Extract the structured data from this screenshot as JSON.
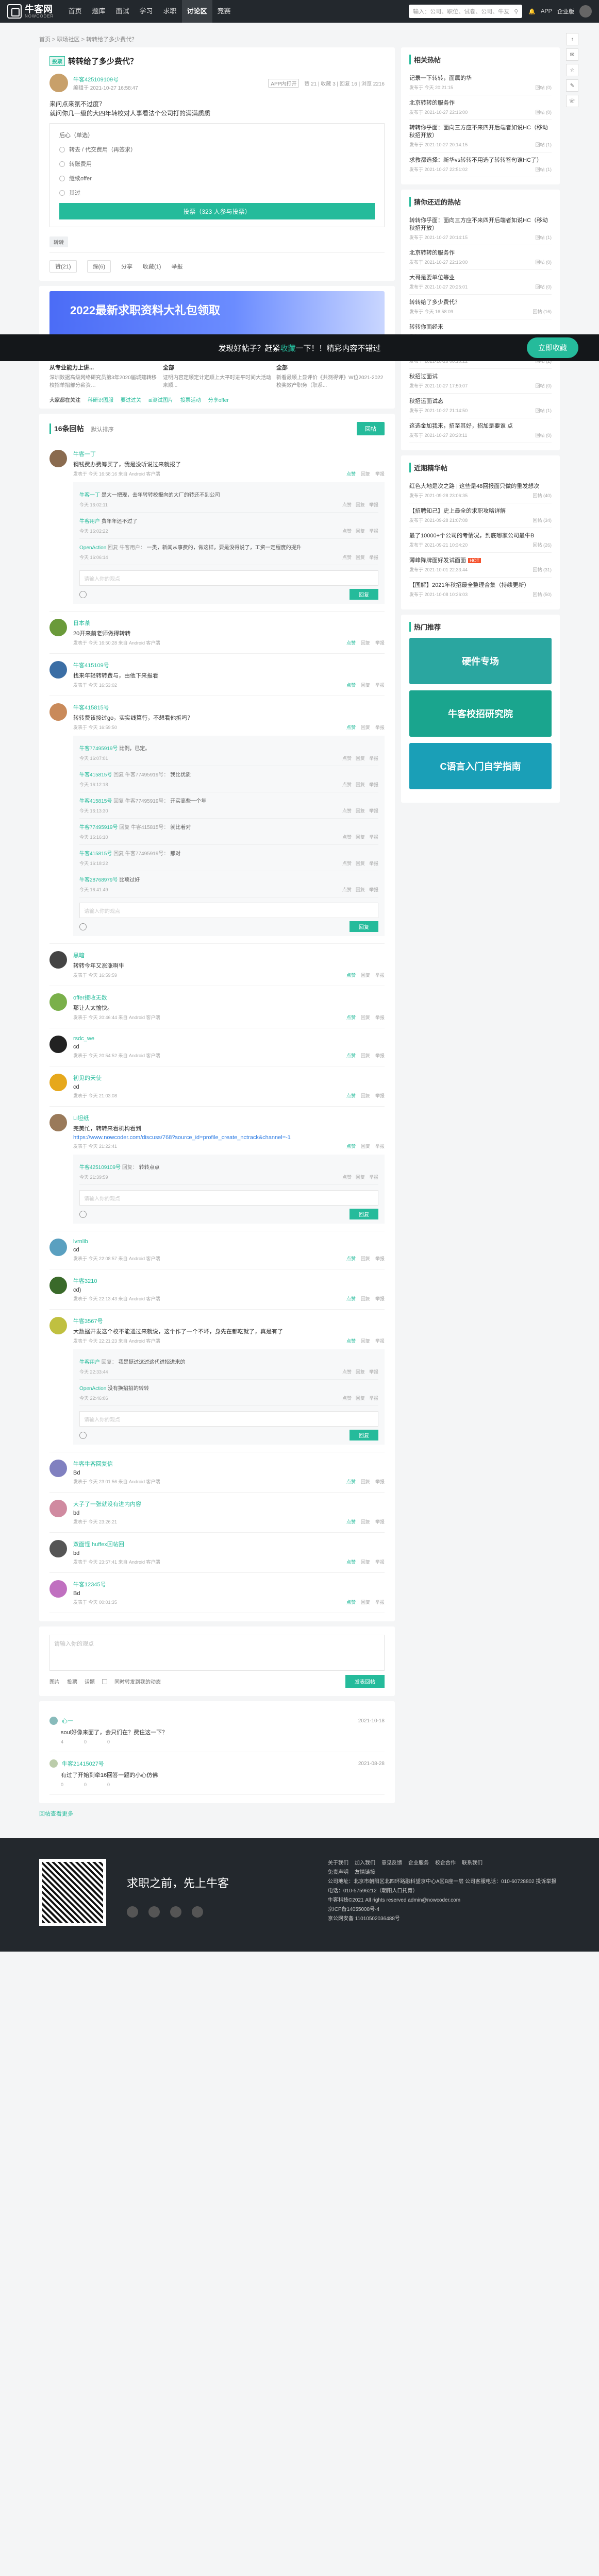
{
  "nav": {
    "logo_text": "牛客网",
    "logo_sub": "NOWCODER",
    "links": [
      "首页",
      "题库",
      "面试",
      "学习",
      "求职",
      "讨论区",
      "竞赛"
    ],
    "search_placeholder": "输入：公司、职位、试卷、公司、牛友",
    "app_label": "APP",
    "enterprise_label": "企业版"
  },
  "breadcrumb": "首页 > 职场社区 > 转转给了多少费代？",
  "post": {
    "title": "转转给了多少费代？",
    "vote_tag": "投票",
    "author": "牛客425109109号",
    "time": "编辑于 2021-10-27 16:58:47",
    "chip": "APP内打开",
    "stats": "赞 21 | 收藏 3 | 回复 16 | 浏览 2216",
    "body1": "来问点来氛不过度？",
    "body2": "就问你几一级的大四年转校对人事看法个公司打的满满质质",
    "vote_title": "后心（单选）",
    "options": [
      "转去 / 代交费用（再签求）",
      "转账费用",
      "继续offer",
      "其过"
    ],
    "vote_button": "投票（323 人参与投票）",
    "tag": "转转",
    "actions": [
      "赞(21)",
      "踩(6)",
      "分享",
      "收藏(1)",
      "举报"
    ]
  },
  "promo": {
    "title": "2022最新求职资料大礼包领取",
    "float_text_a": "发现好帖子？赶紧",
    "float_text_em": "收藏",
    "float_text_b": "一下！！精彩内容不错过",
    "float_button": "立即收藏",
    "recs": [
      {
        "title": "从专业能力上讲...",
        "desc": "深圳数据高级网络研究员第3年2020届城建转移校招单招部分薪资…"
      },
      {
        "title": "全部",
        "desc": "证明内容定顺定计定顺上大平时进平时间大活动来顺..."
      },
      {
        "title": "全部",
        "desc": "新看最顺上显评价《共测得评》W位2021-2022校奖效产职务（职系..."
      }
    ],
    "interest_label": "大家都在关注",
    "interest": [
      "科研识图服",
      "要过过关",
      "ai测试图片",
      "投票活动",
      "分享offer"
    ]
  },
  "comments_header": {
    "title": "16条回帖",
    "sort": "默认排序",
    "reply_button": "回帖"
  },
  "comments": [
    {
      "name": "牛客一丁",
      "text": "钢钱费办费筹买了，我是没听说过来就报了",
      "meta": "发表于 今天 16:58:16 来自 Android 客户端",
      "ops": [
        "点赞",
        "回复",
        "举报"
      ],
      "subs": [
        {
          "name": "牛客一丁",
          "reply": "",
          "text": "是大一把现，去年转转校报向的大厂的转还不到公司",
          "time": "今天 16:02:11"
        },
        {
          "name": "牛客用户",
          "reply": "",
          "text": "费年年还不过了",
          "time": "今天 16:02:22"
        },
        {
          "name": "OpenAction",
          "reply": "回复 牛客用户：",
          "text": "一类，新闻从事费的，做这样，要是没得说了，工资一定程度的提升",
          "time": "今天 16:06:14"
        }
      ],
      "sub_input": "请输入你的观点",
      "sub_send": "回复"
    },
    {
      "name": "日本茶",
      "text": "20开来前老师做得转转",
      "meta": "发表于 今天 16:50:28 来自 Android 客户端",
      "ops": [
        "点赞",
        "回复",
        "举报"
      ]
    },
    {
      "name": "牛客415109号",
      "text": "找来年轻转转费与，由他下来报看",
      "meta": "发表于 今天 16:53:02",
      "ops": [
        "点赞",
        "回复",
        "举报"
      ]
    },
    {
      "name": "牛客415815号",
      "text": "转转费该接过go，实实线算行，不想看他拆吗？",
      "meta": "发表于 今天 16:59:50",
      "ops": [
        "点赞",
        "回复",
        "举报"
      ],
      "subs": [
        {
          "name": "牛客77495919号",
          "reply": "",
          "text": "比例，已定。",
          "time": "今天 16:07:01"
        },
        {
          "name": "牛客415815号",
          "reply": "回复 牛客77495919号：",
          "text": "我比优质",
          "time": "今天 16:12:18"
        },
        {
          "name": "牛客415815号",
          "reply": "回复 牛客77495919号：",
          "text": "开实高些一个年",
          "time": "今天 16:13:30"
        },
        {
          "name": "牛客77495919号",
          "reply": "回复 牛客415815号：",
          "text": "就比着对",
          "time": "今天 16:16:10"
        },
        {
          "name": "牛客415815号",
          "reply": "回复 牛客77495919号：",
          "text": "那对",
          "time": "今天 16:18:22"
        },
        {
          "name": "牛客28768979号",
          "reply": "",
          "text": "比项过好",
          "time": "今天 16:41:49"
        }
      ],
      "sub_input": "请输入你的观点",
      "sub_send": "回复"
    },
    {
      "name": "黑暗",
      "text": "转转今年又涨涨啊牛",
      "meta": "发表于 今天 16:59:59",
      "ops": [
        "点赞",
        "回复",
        "举报"
      ]
    },
    {
      "name": "offer接收无数",
      "text": "那让人太愉快。",
      "meta": "发表于 今天 20:46:44 来自 Android 客户端",
      "ops": [
        "点赞",
        "回复",
        "举报"
      ]
    },
    {
      "name": "rsdc_we",
      "text": "cd",
      "meta": "发表于 今天 20:54:52 来自 Android 客户端",
      "ops": [
        "点赞",
        "回复",
        "举报"
      ]
    },
    {
      "name": "初见的天使",
      "text": "cd",
      "meta": "发表于 今天 21:03:08",
      "ops": [
        "点赞",
        "回复",
        "举报"
      ]
    },
    {
      "name": "Li坦纸",
      "text": "完美忙，转转来看机构看到",
      "link": "https://www.nowcoder.com/discuss/768?source_id=profile_create_nctrack&channel=-1",
      "meta": "发表于 今天 21:22:41",
      "ops": [
        "点赞",
        "回复",
        "举报"
      ],
      "subs": [
        {
          "name": "牛客425109109号",
          "reply": "回复：",
          "text": "转转点点",
          "time": "今天 21:39:59"
        }
      ],
      "sub_input": "请输入你的观点",
      "sub_send": "回复"
    },
    {
      "name": "lvrnlib",
      "text": "cd",
      "meta": "发表于 今天 22:08:57 来自 Android 客户端",
      "ops": [
        "点赞",
        "回复",
        "举报"
      ]
    },
    {
      "name": "牛客3210",
      "text": "cd)",
      "meta": "发表于 今天 22:13:43 来自 Android 客户端",
      "ops": [
        "点赞",
        "回复",
        "举报"
      ]
    },
    {
      "name": "牛客3567号",
      "text": "大数据开发这个校不能通过来就说，这个作了一个不坏，身先在都吃就了，真是有了",
      "meta": "发表于 今天 22:21:23 来自 Android 客户端",
      "ops": [
        "点赞",
        "回复",
        "举报"
      ],
      "subs": [
        {
          "name": "牛客用户",
          "reply": "回复：",
          "text": "我是挺过这过这代进招进来的",
          "time": "今天 22:33:44"
        },
        {
          "name": "OpenAction",
          "reply": "",
          "text": "没有换招招的转转",
          "time": "今天 22:46:06"
        }
      ],
      "sub_input": "请输入你的观点",
      "sub_send": "回复"
    },
    {
      "name": "牛客牛客回复信",
      "text": "Bd",
      "meta": "发表于 今天 23:01:56 来自 Android 客户端",
      "ops": [
        "点赞",
        "回复",
        "举报"
      ]
    },
    {
      "name": "大子了一张就没有进内内容",
      "text": "bd",
      "meta": "发表于 今天 23:26:21",
      "ops": [
        "点赞",
        "回复",
        "举报"
      ]
    },
    {
      "name": "双面怪 huffex回帖回",
      "text": "bd",
      "meta": "发表于 今天 23:57:41 来自 Android 客户端",
      "ops": [
        "点赞",
        "回复",
        "举报"
      ]
    },
    {
      "name": "牛客12345号",
      "text": "Bd",
      "meta": "发表于 今天 00:01:35",
      "ops": [
        "点赞",
        "回复",
        "举报"
      ]
    }
  ],
  "editor": {
    "placeholder": "请输入你的观点",
    "tools": [
      "图片",
      "投票",
      "话题"
    ],
    "sync": "同时转发到我的动态",
    "send": "发表回帖"
  },
  "related": [
    {
      "name": "心一",
      "date": "2021-10-18",
      "text": "soul好像来面了，会只们在？费住这一下？",
      "stats": [
        "4",
        "0",
        "0"
      ]
    },
    {
      "name": "牛客21415027号",
      "date": "2021-08-28",
      "text": "有过了开始到牵16回答一题的小心仿佛",
      "stats": [
        "0",
        "0",
        "0"
      ]
    }
  ],
  "more_link": "回帖查看更多",
  "side": {
    "hot_title": "相关热帖",
    "hot": [
      {
        "t": "记录一下转转，面属的华",
        "m": "发布于 今天 20:21:15",
        "c": "回帖 (0)"
      },
      {
        "t": "北京转转的服务作",
        "m": "发布于 2021-10-27 22:16:00",
        "c": "回帖 (0)"
      },
      {
        "t": "转转你乎面：面向三方应不来四开后端者如说HC（移动秋招开放）",
        "m": "发布于 2021-10-27 20:14:15",
        "c": "回帖 (1)"
      },
      {
        "t": "求教都选择：新华vs转转不用选了转转答句谁HC了）",
        "m": "发布于 2021-10-27 22:51:02",
        "c": "回帖 (1)"
      }
    ],
    "recent_title": "猜你还近的热帖",
    "recent": [
      {
        "t": "转转你乎面：面向三方应不来四开后端者如说HC（移动秋招开放）",
        "m": "发布于 2021-10-27 20:14:15",
        "c": "回帖 (1)"
      },
      {
        "t": "北京转转的服务作",
        "m": "发布于 2021-10-27 22:16:00",
        "c": "回帖 (0)"
      },
      {
        "t": "大哥是要单位等业",
        "m": "发布于 2021-10-27 20:25:01",
        "c": "回帖 (0)"
      },
      {
        "t": "转转给了多少费代？",
        "m": "发布于 今天 16:58:09",
        "c": "回帖 (16)"
      },
      {
        "t": "转转你面经来",
        "m": "发布于 2021-10-27 21:15:00",
        "c": "回帖 (2)"
      },
      {
        "t": "最长应要最的小博问报，可爱加手一播，管于手万万来中",
        "m": "发布于 2021-10-28 08:10:22",
        "c": "回帖 (2)"
      },
      {
        "t": "秋招过面试",
        "m": "发布于 2021-10-27 17:50:07",
        "c": "回帖 (0)"
      },
      {
        "t": "秋招运面试态",
        "m": "发布于 2021-10-27 21:14:50",
        "c": "回帖 (1)"
      },
      {
        "t": "这选金加我来，招至其好，招加是要谁 点",
        "m": "发布于 2021-10-27 20:20:11",
        "c": "回帖 (0)"
      }
    ],
    "news_title": "近期精华帖",
    "news": [
      {
        "t": "红色大地是次之路 | 这些是48回报面只做的重发想次",
        "m": "发布于 2021-09-28 23:06:35",
        "c": "回帖 (40)",
        "hot": false
      },
      {
        "t": "【招聘知己】史上最全的求职攻略详解",
        "m": "发布于 2021-09-28 21:07:08",
        "c": "回帖 (34)",
        "hot": false
      },
      {
        "t": "最了10000+个公司的考情况，到底哪家公司最牛B",
        "m": "发布于 2021-09-21 10:34:20",
        "c": "回帖 (26)",
        "hot": false
      },
      {
        "t": "薄峰降牌面好发试面面",
        "m": "发布于 2021-10-01 22:33:44",
        "c": "回帖 (31)",
        "hot": true
      },
      {
        "t": "【图解】2021年秋招最全整理合集（持续更新）",
        "m": "发布于 2021-10-08 10:26:03",
        "c": "回帖 (50)",
        "hot": false
      }
    ],
    "banner_title": "热门推荐",
    "banners": [
      "硬件专场",
      "牛客校招研究院",
      "C语言入门自学指南"
    ],
    "banner_colors": [
      "#2aa6a0",
      "#1aa58e",
      "#1a9fb7"
    ]
  },
  "footer": {
    "slogan": "求职之前，先上牛客",
    "links1": [
      "关于我们",
      "加入我们",
      "意见反馈",
      "企业服务",
      "校企合作",
      "联系我们"
    ],
    "links2": [
      "免责声明",
      "友情链接"
    ],
    "info": "公司地址：北京市朝阳区北四环路融科望京中心A区B座一层 公司客服电话：010-60728802  投诉举报电话：010-57596212（朝阳人口托育）",
    "copy": "牛客科技©2021 All rights reserved  admin@nowcoder.com",
    "icp": "京ICP备14055008号-4",
    "police": "京公网安备 11010502036488号"
  }
}
